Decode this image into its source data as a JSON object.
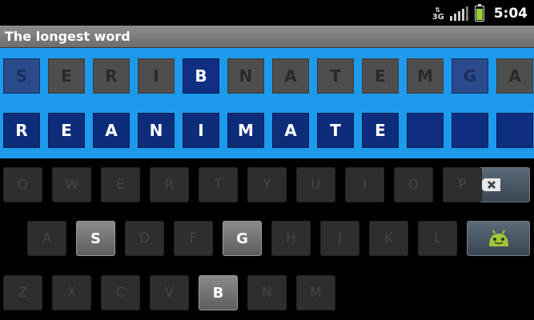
{
  "status_bar": {
    "network": "3G",
    "time": "5:04",
    "icons": [
      "data-arrows-icon",
      "signal-icon",
      "battery-charging-icon"
    ]
  },
  "app": {
    "title": "The longest word"
  },
  "letter_tiles": [
    {
      "letter": "S",
      "state": "used"
    },
    {
      "letter": "E",
      "state": "unused"
    },
    {
      "letter": "R",
      "state": "unused"
    },
    {
      "letter": "I",
      "state": "unused"
    },
    {
      "letter": "B",
      "state": "picked"
    },
    {
      "letter": "N",
      "state": "unused"
    },
    {
      "letter": "A",
      "state": "unused"
    },
    {
      "letter": "T",
      "state": "unused"
    },
    {
      "letter": "E",
      "state": "unused"
    },
    {
      "letter": "M",
      "state": "unused"
    },
    {
      "letter": "G",
      "state": "used"
    },
    {
      "letter": "A",
      "state": "unused"
    }
  ],
  "answer_slots": [
    "R",
    "E",
    "A",
    "N",
    "I",
    "M",
    "A",
    "T",
    "E",
    "",
    "",
    ""
  ],
  "keyboard": {
    "row1": [
      {
        "key": "Q",
        "active": false
      },
      {
        "key": "W",
        "active": false
      },
      {
        "key": "E",
        "active": false
      },
      {
        "key": "R",
        "active": false
      },
      {
        "key": "T",
        "active": false
      },
      {
        "key": "Y",
        "active": false
      },
      {
        "key": "U",
        "active": false
      },
      {
        "key": "I",
        "active": false
      },
      {
        "key": "O",
        "active": false
      },
      {
        "key": "P",
        "active": false
      }
    ],
    "row2": [
      {
        "key": "A",
        "active": false
      },
      {
        "key": "S",
        "active": true
      },
      {
        "key": "D",
        "active": false
      },
      {
        "key": "F",
        "active": false
      },
      {
        "key": "G",
        "active": true
      },
      {
        "key": "H",
        "active": false
      },
      {
        "key": "J",
        "active": false
      },
      {
        "key": "K",
        "active": false
      },
      {
        "key": "L",
        "active": false
      }
    ],
    "row3": [
      {
        "key": "Z",
        "active": false
      },
      {
        "key": "X",
        "active": false
      },
      {
        "key": "C",
        "active": false
      },
      {
        "key": "V",
        "active": false
      },
      {
        "key": "B",
        "active": true
      },
      {
        "key": "N",
        "active": false
      },
      {
        "key": "M",
        "active": false
      }
    ],
    "special_keys": [
      "backspace-icon",
      "android-icon"
    ]
  },
  "colors": {
    "board_background": "#1e9aec",
    "selected_tile": "#0f2f84",
    "title_bar": "#7d7d7d"
  }
}
